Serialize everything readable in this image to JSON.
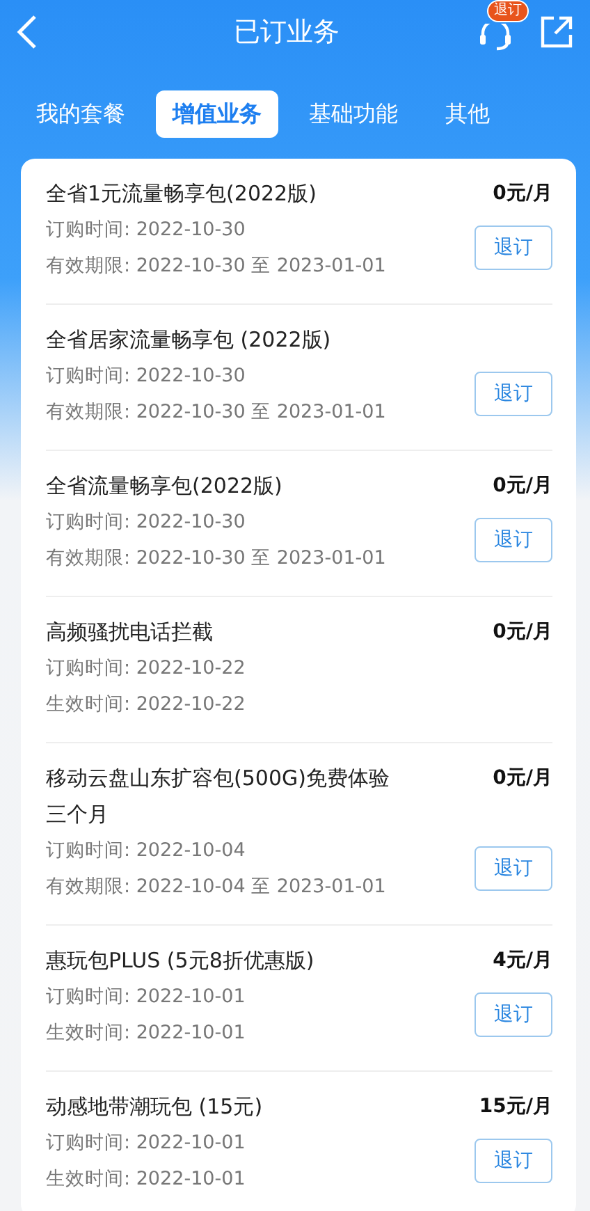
{
  "header": {
    "title": "已订业务",
    "badge": "退订"
  },
  "tabs": [
    {
      "label": "我的套餐",
      "selected": false
    },
    {
      "label": "增值业务",
      "selected": true
    },
    {
      "label": "基础功能",
      "selected": false
    },
    {
      "label": "其他",
      "selected": false
    }
  ],
  "services": [
    {
      "title": "全省1元流量畅享包(2022版)",
      "price": "0元/月",
      "lines": [
        "订购时间: 2022-10-30",
        "有效期限: 2022-10-30 至 2023-01-01"
      ],
      "action": "退订"
    },
    {
      "title": "全省居家流量畅享包 (2022版)",
      "lines": [
        "订购时间: 2022-10-30",
        "有效期限: 2022-10-30 至 2023-01-01"
      ],
      "action": "退订"
    },
    {
      "title": "全省流量畅享包(2022版)",
      "price": "0元/月",
      "lines": [
        "订购时间: 2022-10-30",
        "有效期限: 2022-10-30 至 2023-01-01"
      ],
      "action": "退订"
    },
    {
      "title": "高频骚扰电话拦截",
      "price": "0元/月",
      "lines": [
        "订购时间: 2022-10-22",
        "生效时间: 2022-10-22"
      ]
    },
    {
      "title": "移动云盘山东扩容包(500G)免费体验三个月",
      "price": "0元/月",
      "lines": [
        "订购时间: 2022-10-04",
        "有效期限: 2022-10-04 至 2023-01-01"
      ],
      "action": "退订"
    },
    {
      "title": "惠玩包PLUS (5元8折优惠版)",
      "price": "4元/月",
      "lines": [
        "订购时间: 2022-10-01",
        "生效时间: 2022-10-01"
      ],
      "action": "退订"
    },
    {
      "title": "动感地带潮玩包 (15元)",
      "price": "15元/月",
      "lines": [
        "订购时间: 2022-10-01",
        "生效时间: 2022-10-01"
      ],
      "action": "退订"
    }
  ]
}
